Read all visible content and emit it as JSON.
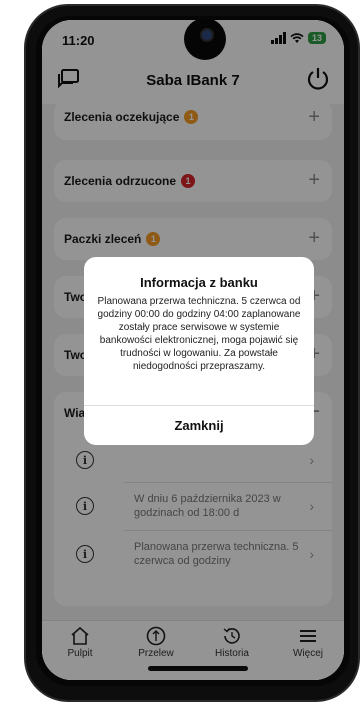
{
  "status_bar": {
    "time": "11:20",
    "battery": "13"
  },
  "header": {
    "title": "Saba IBank 7",
    "icons": [
      "chat-icon",
      "power-icon"
    ]
  },
  "sections": [
    {
      "label": "Zlecenia oczekujące",
      "badge": "1",
      "badge_color": "#f59b23"
    },
    {
      "label": "Zlecenia odrzucone",
      "badge": "1",
      "badge_color": "#d8232a"
    },
    {
      "label": "Paczki zleceń",
      "badge": "1",
      "badge_color": "#f59b23"
    },
    {
      "label": "Two",
      "badge": ""
    },
    {
      "label": "Two",
      "badge": ""
    }
  ],
  "news": {
    "header_label": "Wia",
    "items": [
      {
        "text": ""
      },
      {
        "text": "W dniu 6 października 2023 w godzinach od 18:00 d"
      },
      {
        "text": "Planowana przerwa techniczna. 5 czerwca od godziny"
      }
    ]
  },
  "dialog": {
    "title": "Informacja z banku",
    "body": "Planowana przerwa techniczna. 5 czerwca od godziny 00:00 do godziny 04:00 zaplanowane zostały prace serwisowe w systemie bankowości elektronicznej, moga pojawić się trudności w logowaniu. Za powstałe niedogodności przepraszamy.",
    "button_label": "Zamknij"
  },
  "tab_bar": {
    "items": [
      {
        "label": "Pulpit",
        "icon": "home-icon"
      },
      {
        "label": "Przelew",
        "icon": "transfer-icon"
      },
      {
        "label": "Historia",
        "icon": "history-icon"
      },
      {
        "label": "Więcej",
        "icon": "menu-icon"
      }
    ]
  },
  "colors": {
    "accent_orange": "#f59b23",
    "alert_red": "#d8232a",
    "battery_green": "#2e9e46"
  }
}
